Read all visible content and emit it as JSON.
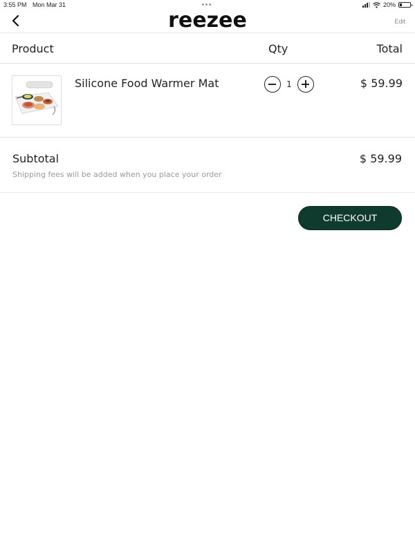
{
  "status_bar": {
    "time": "3:55 PM",
    "date": "Mon Mar 31",
    "battery_percent": "20%",
    "battery_level": 0.2,
    "icons": [
      "signal-icon",
      "wifi-icon",
      "battery-icon"
    ]
  },
  "header": {
    "back_icon": "chevron-left-icon",
    "brand": "reezee",
    "edit_label": "Edit"
  },
  "columns": {
    "product": "Product",
    "qty": "Qty",
    "total": "Total"
  },
  "cart": {
    "items": [
      {
        "name": "Silicone Food Warmer Mat",
        "quantity": "1",
        "total": "$ 59.99"
      }
    ]
  },
  "summary": {
    "subtotal_label": "Subtotal",
    "subtotal_value": "$ 59.99",
    "shipping_note": "Shipping fees will be added when you place your order"
  },
  "checkout": {
    "label": "CHECKOUT"
  },
  "colors": {
    "checkout_bg": "#0f3b2f",
    "divider": "#e2e2e2",
    "muted_text": "#9a9a9a"
  }
}
